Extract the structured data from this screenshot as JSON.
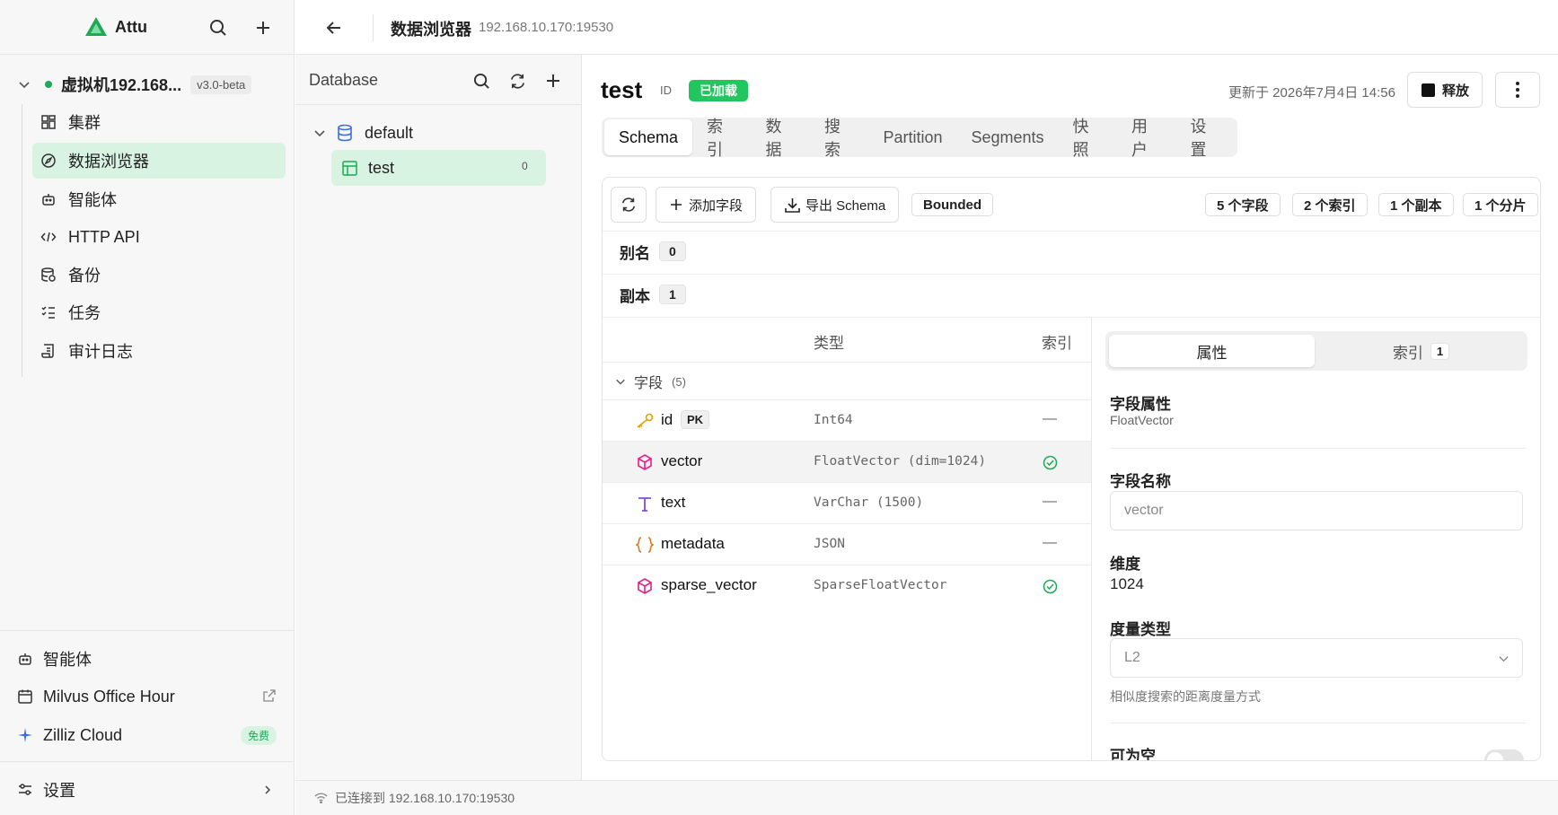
{
  "app": {
    "name": "Attu"
  },
  "sidebar": {
    "connection": {
      "name": "虚拟机192.168...",
      "version": "v3.0-beta"
    },
    "items": [
      {
        "label": "集群",
        "icon": "grid-icon"
      },
      {
        "label": "数据浏览器",
        "icon": "compass-icon"
      },
      {
        "label": "智能体",
        "icon": "bot-icon"
      },
      {
        "label": "HTTP API",
        "icon": "code-icon"
      },
      {
        "label": "备份",
        "icon": "database-backup-icon"
      },
      {
        "label": "任务",
        "icon": "tasks-icon"
      },
      {
        "label": "审计日志",
        "icon": "scroll-icon"
      }
    ],
    "footer": {
      "agent": "智能体",
      "office_hour": "Milvus Office Hour",
      "zilliz": "Zilliz Cloud",
      "zilliz_badge": "免费",
      "settings": "设置"
    }
  },
  "topbar": {
    "title": "数据浏览器",
    "address": "192.168.10.170:19530"
  },
  "db_panel": {
    "title": "Database",
    "database": "default",
    "collection": "test",
    "collection_count": "0"
  },
  "collection": {
    "name": "test",
    "id_label": "ID",
    "status": "已加载",
    "updated": "更新于 2026年7月4日 14:56",
    "release_label": "释放"
  },
  "tabs": [
    "Schema",
    "索引",
    "数据",
    "搜索",
    "Partition",
    "Segments",
    "快照",
    "用户",
    "设置"
  ],
  "toolbar": {
    "add_field": "添加字段",
    "export_schema": "导出 Schema",
    "bounded": "Bounded",
    "stats": [
      "5 个字段",
      "2 个索引",
      "1 个副本",
      "1 个分片"
    ]
  },
  "alias": {
    "label": "别名",
    "count": "0"
  },
  "replica": {
    "label": "副本",
    "count": "1"
  },
  "schema_table": {
    "col_type": "类型",
    "col_index": "索引",
    "group_label": "字段",
    "group_count": "(5)",
    "fields": [
      {
        "name": "id",
        "badge": "PK",
        "type": "Int64",
        "index": "—",
        "icon": "key-icon",
        "color": "#e0a100"
      },
      {
        "name": "vector",
        "badge": "",
        "type": "FloatVector (dim=1024)",
        "index": "check",
        "icon": "cube-icon",
        "color": "#e0218a"
      },
      {
        "name": "text",
        "badge": "",
        "type": "VarChar (1500)",
        "index": "—",
        "icon": "text-type-icon",
        "color": "#7a4ee0"
      },
      {
        "name": "metadata",
        "badge": "",
        "type": "JSON",
        "index": "—",
        "icon": "braces-icon",
        "color": "#e07a1a"
      },
      {
        "name": "sparse_vector",
        "badge": "",
        "type": "SparseFloatVector",
        "index": "check",
        "icon": "cube-icon",
        "color": "#e0218a"
      }
    ]
  },
  "props": {
    "tab_props": "属性",
    "tab_index": "索引",
    "tab_index_count": "1",
    "field_props_label": "字段属性",
    "field_props_value": "FloatVector",
    "field_name_label": "字段名称",
    "field_name_value": "vector",
    "dim_label": "维度",
    "dim_value": "1024",
    "metric_label": "度量类型",
    "metric_value": "L2",
    "metric_hint": "相似度搜索的距离度量方式",
    "nullable_label": "可为空"
  },
  "statusbar": {
    "text": "已连接到 192.168.10.170:19530"
  },
  "colors": {
    "accent": "#1fa855",
    "active_bg": "#d9f3e3",
    "status_badge": "#22c55e"
  }
}
